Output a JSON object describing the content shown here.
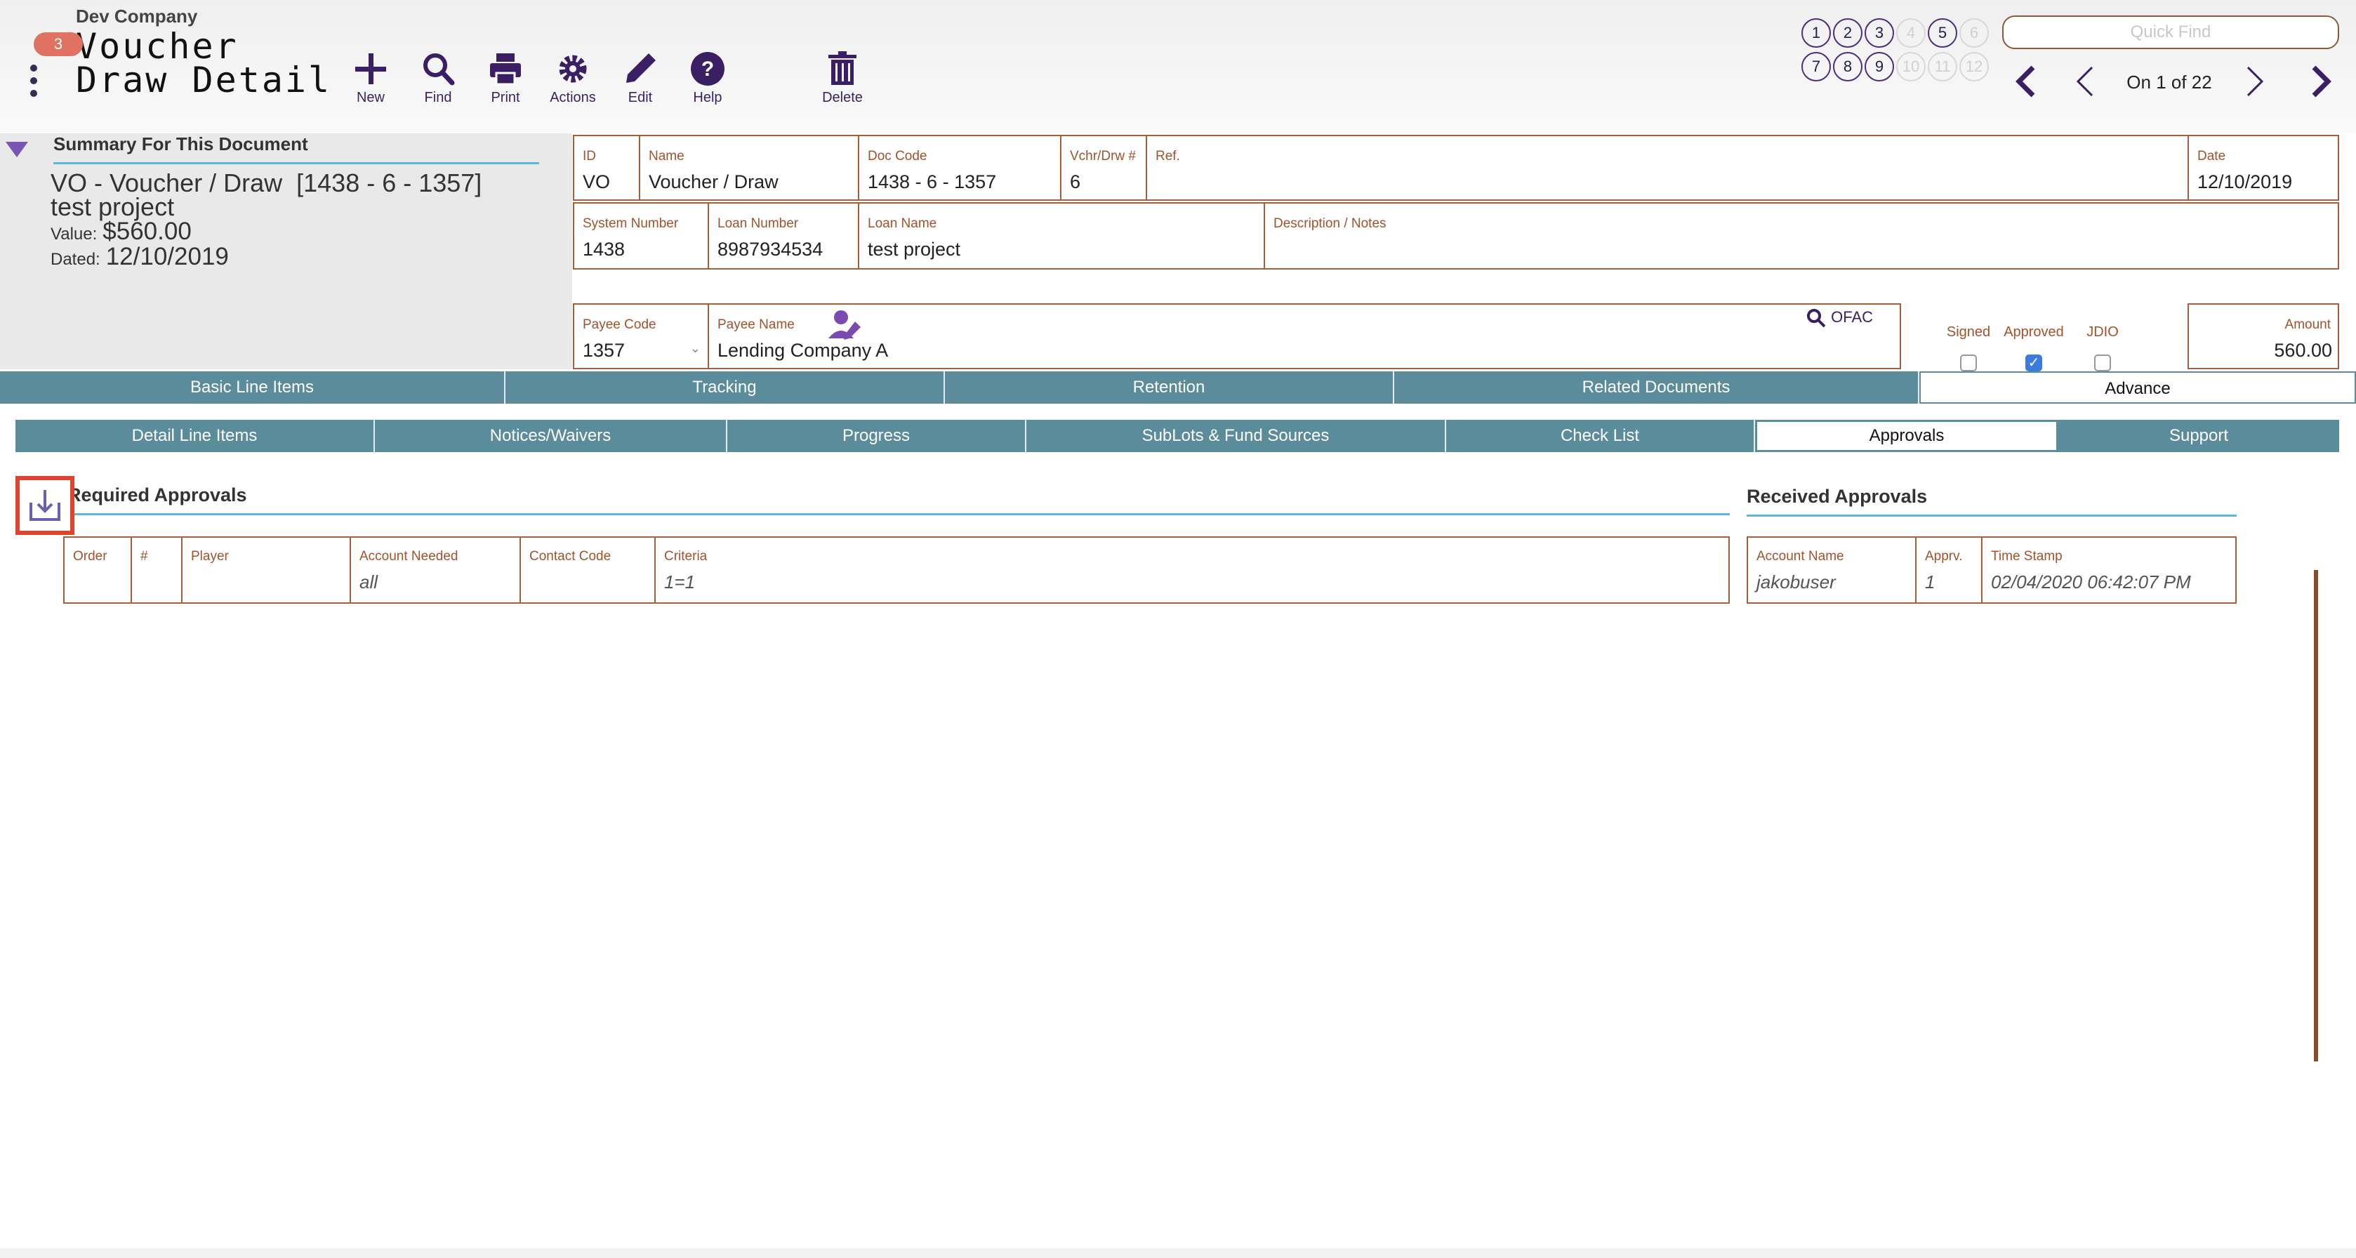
{
  "header": {
    "company": "Dev Company",
    "badge": "3",
    "title_line1": "Voucher",
    "title_line2": "Draw Detail",
    "toolbar": [
      {
        "label": "New",
        "icon": "plus-icon"
      },
      {
        "label": "Find",
        "icon": "search-icon"
      },
      {
        "label": "Print",
        "icon": "print-icon"
      },
      {
        "label": "Actions",
        "icon": "gear-icon"
      },
      {
        "label": "Edit",
        "icon": "pencil-icon"
      },
      {
        "label": "Help",
        "icon": "help-icon"
      }
    ],
    "delete_label": "Delete",
    "page_buttons": [
      "1",
      "2",
      "3",
      "4",
      "5",
      "6",
      "7",
      "8",
      "9",
      "10",
      "11",
      "12"
    ],
    "quick_find_placeholder": "Quick Find",
    "record_position": "On 1 of 22"
  },
  "summary": {
    "heading": "Summary For This Document",
    "line1": "VO - Voucher / Draw  [1438 - 6 - 1357]",
    "line2": "test project",
    "value_label": "Value:",
    "value": "$560.00",
    "dated_label": "Dated:",
    "dated": "12/10/2019"
  },
  "fields": {
    "id": {
      "label": "ID",
      "value": "VO"
    },
    "name": {
      "label": "Name",
      "value": "Voucher / Draw"
    },
    "doc_code": {
      "label": "Doc Code",
      "value": "1438 - 6 - 1357"
    },
    "vchr_drw": {
      "label": "Vchr/Drw #",
      "value": "6"
    },
    "ref": {
      "label": "Ref.",
      "value": ""
    },
    "date": {
      "label": "Date",
      "value": "12/10/2019"
    },
    "system_number": {
      "label": "System Number",
      "value": "1438"
    },
    "loan_number": {
      "label": "Loan Number",
      "value": "8987934534"
    },
    "loan_name": {
      "label": "Loan Name",
      "value": "test project"
    },
    "description": {
      "label": "Description / Notes",
      "value": ""
    },
    "payee_code": {
      "label": "Payee Code",
      "value": "1357"
    },
    "payee_name": {
      "label": "Payee Name",
      "value": "Lending Company A"
    },
    "ofac": "OFAC",
    "signed": {
      "label": "Signed",
      "checked": false
    },
    "approved": {
      "label": "Approved",
      "checked": true
    },
    "jdio": {
      "label": "JDIO",
      "checked": false
    },
    "amount": {
      "label": "Amount",
      "value": "560.00"
    }
  },
  "tabs_primary": [
    {
      "label": "Basic Line Items",
      "active": false
    },
    {
      "label": "Tracking",
      "active": false
    },
    {
      "label": "Retention",
      "active": false
    },
    {
      "label": "Related Documents",
      "active": false
    },
    {
      "label": "Advance",
      "active": true
    }
  ],
  "tabs_secondary": [
    {
      "label": "Detail Line Items",
      "active": false
    },
    {
      "label": "Notices/Waivers",
      "active": false
    },
    {
      "label": "Progress",
      "active": false
    },
    {
      "label": "SubLots & Fund Sources",
      "active": false
    },
    {
      "label": "Check List",
      "active": false
    },
    {
      "label": "Approvals",
      "active": true
    },
    {
      "label": "Support",
      "active": false
    }
  ],
  "required_approvals": {
    "heading": "Required Approvals",
    "columns": [
      "Order",
      "#",
      "Player",
      "Account Needed",
      "Contact Code",
      "Criteria"
    ],
    "row": [
      "",
      "",
      "",
      "all",
      "",
      "1=1"
    ]
  },
  "received_approvals": {
    "heading": "Received Approvals",
    "columns": [
      "Account Name",
      "Apprv.",
      "Time Stamp"
    ],
    "row": [
      "jakobuser",
      "1",
      "02/04/2020 06:42:07 PM"
    ]
  },
  "colors": {
    "accent_purple": "#3a1f64",
    "tab_teal": "#5a8c9c",
    "field_border": "#a4603c",
    "highlight_red": "#e0422e"
  }
}
